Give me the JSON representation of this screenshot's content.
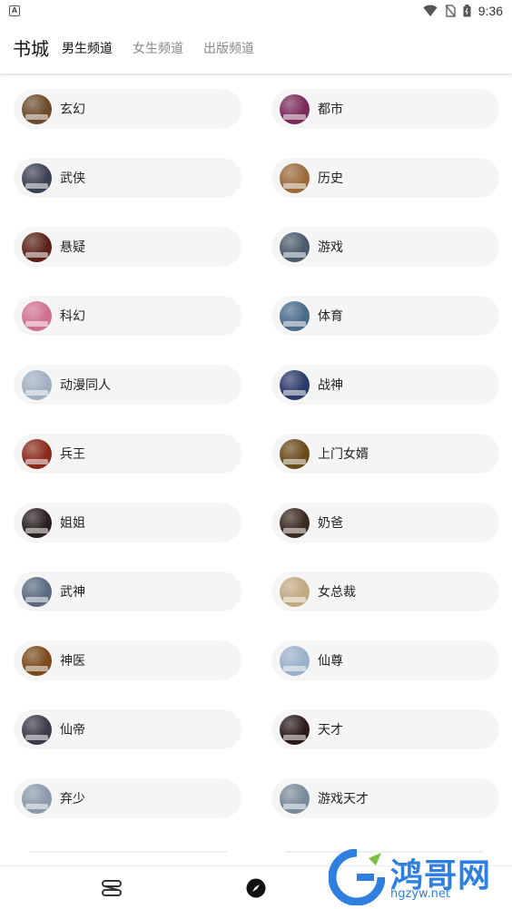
{
  "status_bar": {
    "notification_icon": "A",
    "time": "9:36"
  },
  "header": {
    "title": "书城",
    "tabs": [
      {
        "label": "男生频道",
        "active": true
      },
      {
        "label": "女生频道",
        "active": false
      },
      {
        "label": "出版频道",
        "active": false
      }
    ]
  },
  "categories": [
    {
      "label": "玄幻",
      "color": "#6b4a2a"
    },
    {
      "label": "都市",
      "color": "#7a2a5a"
    },
    {
      "label": "武侠",
      "color": "#3a4050"
    },
    {
      "label": "历史",
      "color": "#9a6a3a"
    },
    {
      "label": "悬疑",
      "color": "#5a2018"
    },
    {
      "label": "游戏",
      "color": "#4a5a6a"
    },
    {
      "label": "科幻",
      "color": "#d07090"
    },
    {
      "label": "体育",
      "color": "#4a6a8a"
    },
    {
      "label": "动漫同人",
      "color": "#a0b0c0"
    },
    {
      "label": "战神",
      "color": "#2a3a6a"
    },
    {
      "label": "兵王",
      "color": "#8a2a1a"
    },
    {
      "label": "上门女婿",
      "color": "#6a4a1a"
    },
    {
      "label": "姐姐",
      "color": "#2a2020"
    },
    {
      "label": "奶爸",
      "color": "#3a2a20"
    },
    {
      "label": "武神",
      "color": "#5a6a80"
    },
    {
      "label": "女总裁",
      "color": "#c0a880"
    },
    {
      "label": "神医",
      "color": "#7a4a1a"
    },
    {
      "label": "仙尊",
      "color": "#9ab0c8"
    },
    {
      "label": "仙帝",
      "color": "#3a3a4a"
    },
    {
      "label": "天才",
      "color": "#2a1a1a"
    },
    {
      "label": "弃少",
      "color": "#8a9aaa"
    },
    {
      "label": "游戏天才",
      "color": "#7a8a9a"
    }
  ],
  "bottom_nav": {
    "items": [
      {
        "icon": "bookshelf-icon"
      },
      {
        "icon": "compass-icon"
      }
    ]
  },
  "watermark": {
    "text": "鸿哥网",
    "url": "hgzyw.net"
  }
}
